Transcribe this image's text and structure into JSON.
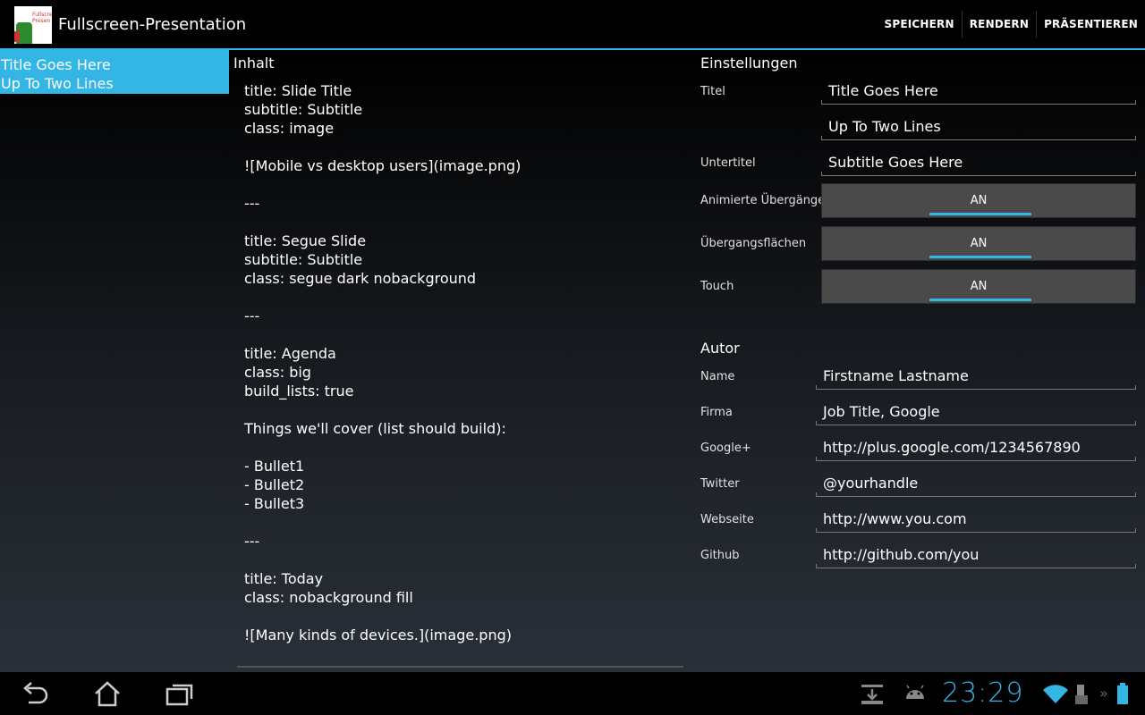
{
  "app": {
    "title": "Fullscreen-Presentation",
    "icon_text": "Fullscreen Presen",
    "actions": [
      "SPEICHERN",
      "RENDERN",
      "PRÄSENTIEREN"
    ]
  },
  "slide_list": {
    "selected_item": "Title Goes Here\nUp To Two Lines"
  },
  "content": {
    "header": "Inhalt",
    "lines": [
      "title: Slide Title",
      "subtitle: Subtitle",
      "class: image",
      "",
      "![Mobile vs desktop users](image.png)",
      "",
      "---",
      "",
      "title: Segue Slide",
      "subtitle: Subtitle",
      "class: segue dark nobackground",
      "",
      "---",
      "",
      "title: Agenda",
      "class: big",
      "build_lists: true",
      "",
      "Things we'll cover (list should build):",
      "",
      "- Bullet1",
      "- Bullet2",
      "- Bullet3",
      "",
      "---",
      "",
      "title: Today",
      "class: nobackground fill",
      "",
      "![Many kinds of devices.](image.png)"
    ]
  },
  "settings": {
    "header": "Einstellungen",
    "titel_label": "Titel",
    "titel_line1": "Title Goes Here",
    "titel_line2": "Up To Two Lines",
    "untertitel_label": "Untertitel",
    "untertitel_value": "Subtitle Goes Here",
    "animated_label": "Animierte Übergänge",
    "animated_value": "AN",
    "surfaces_label": "Übergangsflächen",
    "surfaces_value": "AN",
    "touch_label": "Touch",
    "touch_value": "AN"
  },
  "author": {
    "header": "Autor",
    "name_label": "Name",
    "name_value": "Firstname Lastname",
    "firma_label": "Firma",
    "firma_value": "Job Title, Google",
    "google_label": "Google+",
    "google_value": "http://plus.google.com/1234567890",
    "twitter_label": "Twitter",
    "twitter_value": "@yourhandle",
    "web_label": "Webseite",
    "web_value": "http://www.you.com",
    "github_label": "Github",
    "github_value": "http://github.com/you"
  },
  "statusbar": {
    "time": "23:29",
    "icons": [
      "download-icon",
      "android-icon",
      "wifi-icon",
      "keyboard-battery-icon",
      "battery-icon"
    ]
  },
  "colors": {
    "accent": "#33b5e5",
    "spellcheck": "#e53935"
  }
}
